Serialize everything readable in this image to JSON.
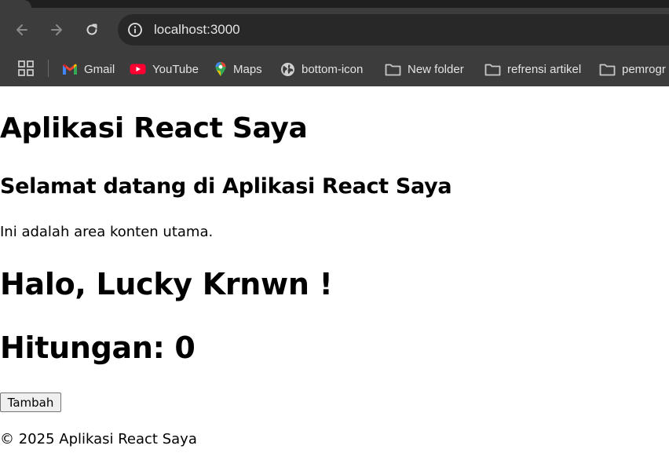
{
  "browser": {
    "url": "localhost:3000",
    "icons": {
      "back": "arrow-left-icon",
      "forward": "arrow-right-icon",
      "reload": "reload-icon",
      "site_info": "info-icon",
      "apps": "apps-grid-icon"
    },
    "bookmarks": [
      {
        "label": "Gmail",
        "icon": "gmail-icon"
      },
      {
        "label": "YouTube",
        "icon": "youtube-icon"
      },
      {
        "label": "Maps",
        "icon": "maps-pin-icon"
      },
      {
        "label": "bottom-icon",
        "icon": "globe-icon"
      },
      {
        "label": "New folder",
        "icon": "folder-icon"
      },
      {
        "label": "refrensi artikel",
        "icon": "folder-icon"
      },
      {
        "label": "pemrogr",
        "icon": "folder-icon"
      }
    ],
    "colors": {
      "chrome_bg": "#3c3c3c",
      "omnibox_bg": "#282828",
      "chrome_text": "#e3e3e3"
    }
  },
  "page": {
    "title": "Aplikasi React Saya",
    "welcome": "Selamat datang di Aplikasi React Saya",
    "content": "Ini adalah area konten utama.",
    "greeting": "Halo, Lucky Krnwn !",
    "counter": "Hitungan: 0",
    "add_button": "Tambah",
    "footer": "© 2025 Aplikasi React Saya"
  }
}
